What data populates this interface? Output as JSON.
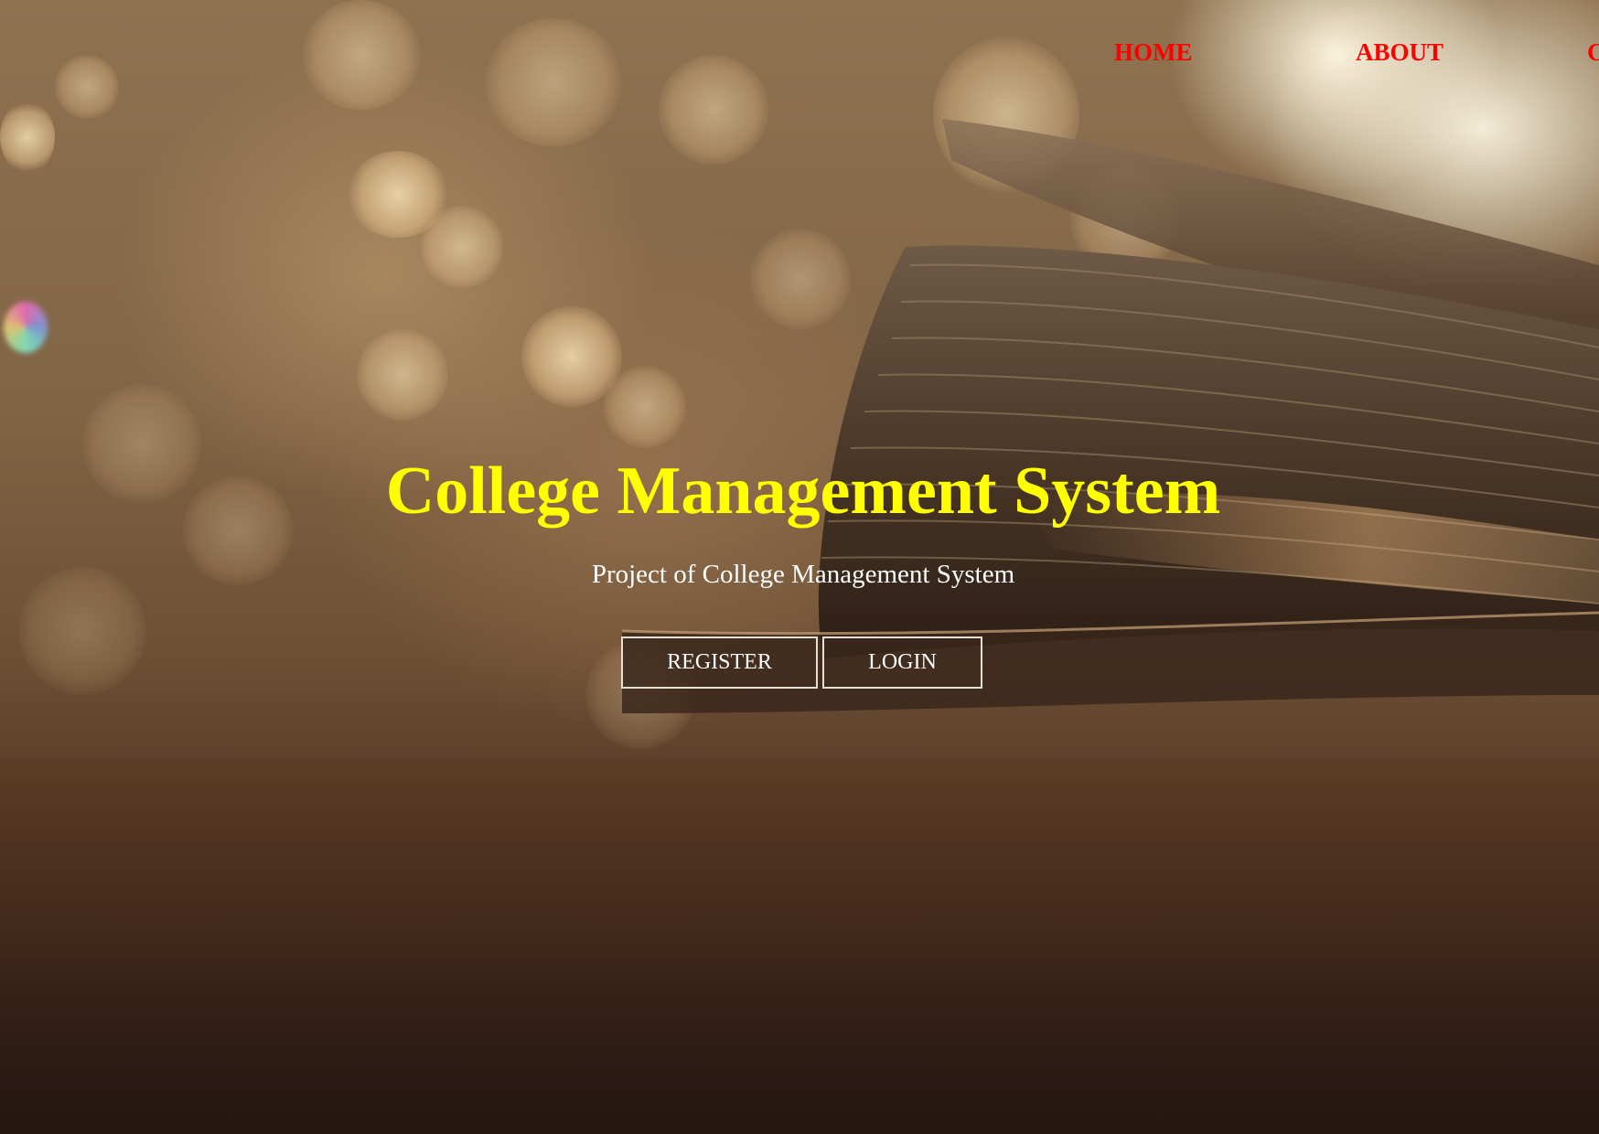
{
  "nav": {
    "items": [
      {
        "label": "HOME"
      },
      {
        "label": "ABOUT"
      },
      {
        "label": "C"
      }
    ],
    "color": "#ff0000"
  },
  "hero": {
    "title": "College Management System",
    "title_color": "#ffff00",
    "subtitle": "Project of College Management System",
    "buttons": {
      "register_label": "REGISTER",
      "login_label": "LOGIN"
    },
    "background_image": "open-book-bokeh-photo"
  }
}
